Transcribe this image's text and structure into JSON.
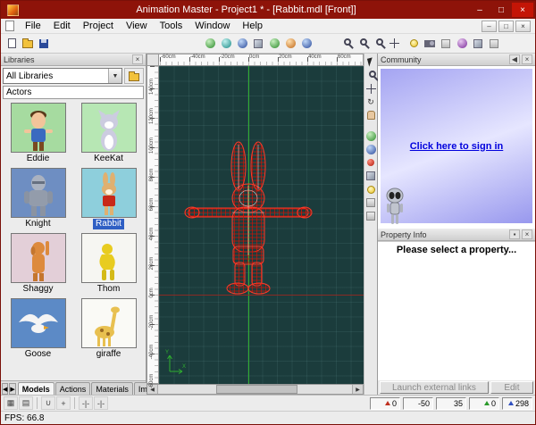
{
  "titlebar": {
    "title": "Animation Master - Project1 * - [Rabbit.mdl [Front]]"
  },
  "menubar": {
    "items": [
      "File",
      "Edit",
      "Project",
      "View",
      "Tools",
      "Window",
      "Help"
    ]
  },
  "libraries": {
    "header": "Libraries",
    "combo_value": "All Libraries",
    "path": "Actors",
    "items": [
      {
        "name": "Eddie"
      },
      {
        "name": "KeeKat"
      },
      {
        "name": "Knight"
      },
      {
        "name": "Rabbit",
        "selected": true
      },
      {
        "name": "Shaggy"
      },
      {
        "name": "Thom"
      },
      {
        "name": "Goose"
      },
      {
        "name": "giraffe"
      }
    ],
    "tabs": [
      {
        "label": "Models",
        "active": true
      },
      {
        "label": "Actions"
      },
      {
        "label": "Materials"
      },
      {
        "label": "Images"
      }
    ]
  },
  "viewport": {
    "ruler_top_labels": [
      "-60cm",
      "-40cm",
      "-20cm",
      "0cm",
      "20cm",
      "40cm",
      "60cm"
    ],
    "ruler_left_labels": [
      "140cm",
      "120cm",
      "100cm",
      "80cm",
      "60cm",
      "40cm",
      "20cm",
      "0cm",
      "-20cm",
      "-40cm",
      "-60cm"
    ],
    "axis_y_label": "Y",
    "axis_x_label": "X"
  },
  "community": {
    "header": "Community",
    "sign_in_link": "Click here to sign in"
  },
  "property_info": {
    "header": "Property Info",
    "message": "Please select a property..."
  },
  "footer_buttons": {
    "launch": "Launch external links",
    "edit": "Edit"
  },
  "statusbar": {
    "fps": "FPS: 66.8",
    "readouts": [
      "0",
      "-50",
      "35",
      "0",
      "298"
    ]
  },
  "icons": {
    "minimize": "–",
    "maximize": "□",
    "close": "×",
    "dropdown": "▼",
    "left": "◀",
    "right": "▶",
    "rotate": "↻",
    "pin": "▪",
    "grid": "▦",
    "list": "▤",
    "magnet": "∪",
    "plus": "+",
    "snap_a": "-|-",
    "snap_b": "-|-"
  },
  "colors": {
    "titlebar": "#8e1309",
    "viewport_bg": "#1b3c3c",
    "selection": "#2f5fc4",
    "axis_green": "#2fae2f",
    "ground_red": "#8a2a24",
    "wireframe_red": "#ff3a28"
  }
}
